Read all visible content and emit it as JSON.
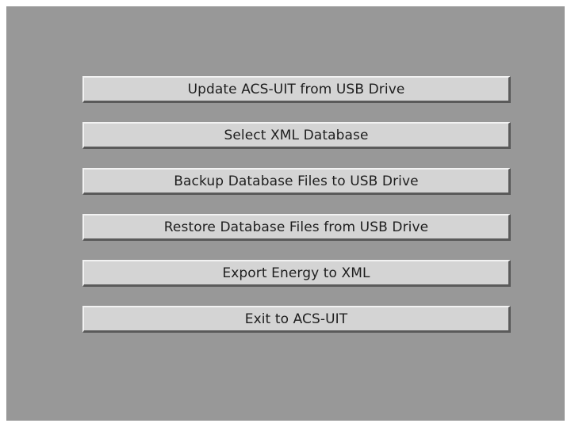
{
  "menu": {
    "buttons": [
      {
        "label": "Update ACS-UIT from USB Drive"
      },
      {
        "label": "Select XML Database"
      },
      {
        "label": "Backup Database Files to USB Drive"
      },
      {
        "label": "Restore Database Files from USB Drive"
      },
      {
        "label": "Export Energy to XML"
      },
      {
        "label": "Exit to ACS-UIT"
      }
    ]
  },
  "colors": {
    "background": "#989898",
    "button_face": "#d4d4d4",
    "button_highlight": "#f2f2f2",
    "button_shadow": "#5a5a5a",
    "text": "#1e1e1e"
  }
}
